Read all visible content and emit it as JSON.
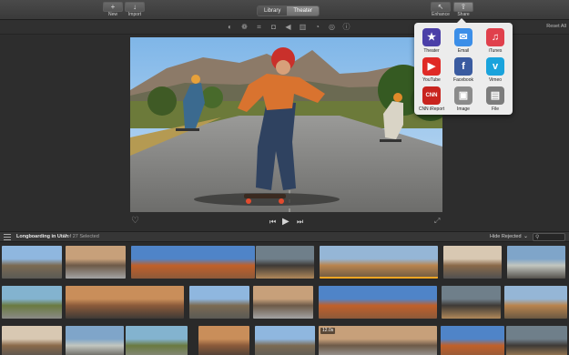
{
  "toolbar": {
    "new_label": "New",
    "import_label": "Import",
    "library_tab": "Library",
    "theater_tab": "Theater",
    "enhance_label": "Enhance",
    "share_label": "Share"
  },
  "adjustments": {
    "icons": [
      "color-balance-icon",
      "color-correction-icon",
      "crop-icon",
      "stabilization-icon",
      "volume-icon",
      "noise-reduction-icon",
      "speed-icon",
      "clip-filter-icon",
      "info-icon"
    ],
    "reset_all": "Reset All"
  },
  "browser": {
    "project_title": "Longboarding in Utah",
    "selection_count": "1 of 27 Selected",
    "hide_rejected": "Hide Rejected"
  },
  "clips": {
    "selected_index": 4,
    "timestamp": "12.0s"
  },
  "share_menu": {
    "items": [
      {
        "label": "Theater",
        "icon": "theater-star-icon",
        "color": "#4b3fa8"
      },
      {
        "label": "Email",
        "icon": "email-icon",
        "color": "#3b8ee8"
      },
      {
        "label": "iTunes",
        "icon": "itunes-icon",
        "color": "#e0404c"
      },
      {
        "label": "YouTube",
        "icon": "youtube-icon",
        "color": "#e02a26"
      },
      {
        "label": "Facebook",
        "icon": "facebook-icon",
        "color": "#3a5ba0"
      },
      {
        "label": "Vimeo",
        "icon": "vimeo-icon",
        "color": "#1aa3dc"
      },
      {
        "label": "CNN iReport",
        "icon": "cnn-ireport-icon",
        "color": "#c8241e"
      },
      {
        "label": "Image",
        "icon": "image-icon",
        "color": "#8b8b8b"
      },
      {
        "label": "File",
        "icon": "file-icon",
        "color": "#7c7c7c"
      }
    ]
  },
  "colors": {
    "accent": "#f5a623",
    "toolbar": "#444444",
    "popover": "#ececec"
  }
}
